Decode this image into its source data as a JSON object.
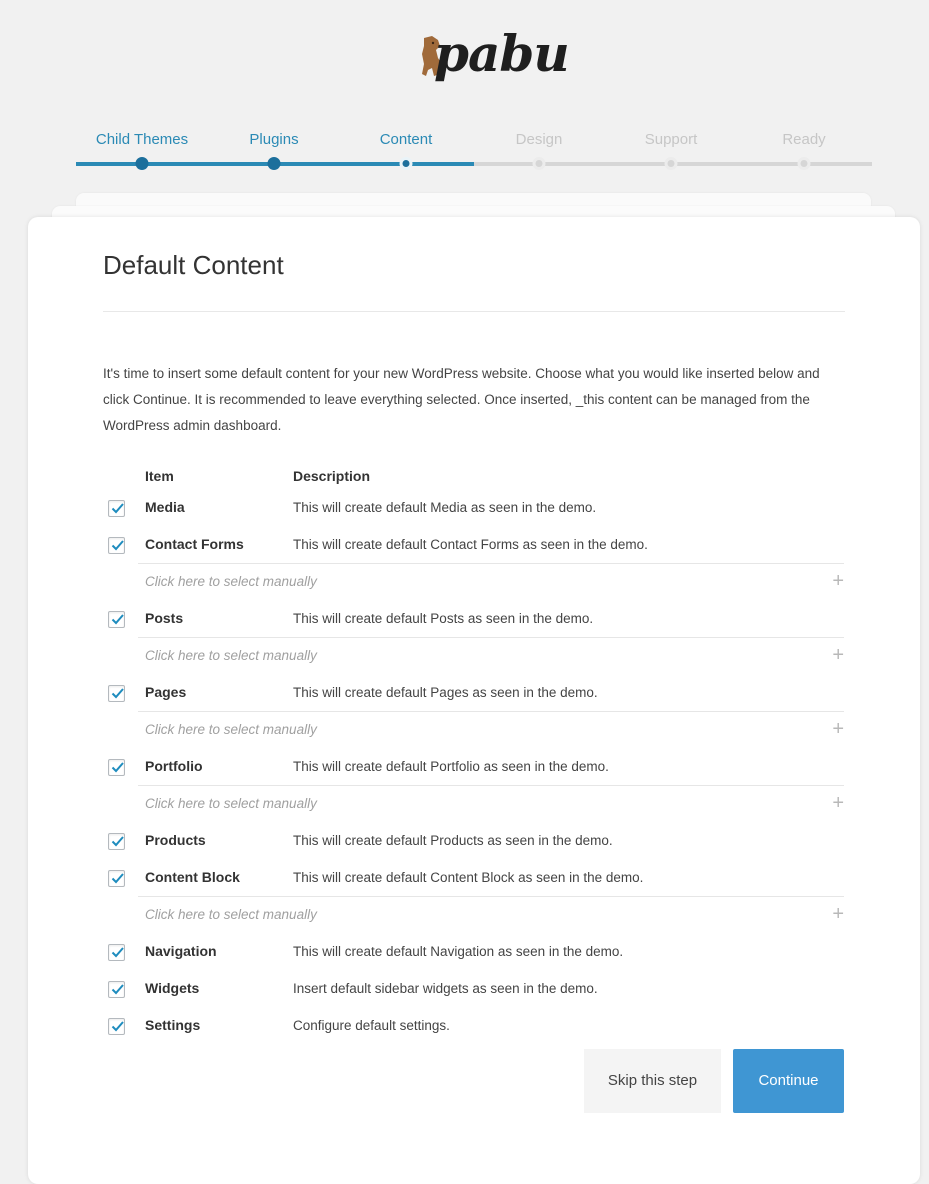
{
  "logo": {
    "text": "pabu",
    "icon": "dog-icon"
  },
  "steps": [
    {
      "label": "Child Themes",
      "state": "done"
    },
    {
      "label": "Plugins",
      "state": "done"
    },
    {
      "label": "Content",
      "state": "current"
    },
    {
      "label": "Design",
      "state": "todo"
    },
    {
      "label": "Support",
      "state": "todo"
    },
    {
      "label": "Ready",
      "state": "todo"
    }
  ],
  "colors": {
    "accent": "#2b8ab5",
    "button_primary": "#3f96d3",
    "inactive": "#c6c6c6"
  },
  "page": {
    "title": "Default Content",
    "intro": "It's time to insert some default content for your new WordPress website. Choose what you would like inserted below and click Continue. It is recommended to leave everything selected. Once inserted, _this content can be managed from the WordPress admin dashboard."
  },
  "table": {
    "headers": {
      "item": "Item",
      "description": "Description"
    },
    "manual_text": "Click here to select manually",
    "rows": [
      {
        "item": "Media",
        "description": "This will create default Media as seen in the demo.",
        "checked": true,
        "manual": false
      },
      {
        "item": "Contact Forms",
        "description": "This will create default Contact Forms as seen in the demo.",
        "checked": true,
        "manual": true
      },
      {
        "item": "Posts",
        "description": "This will create default Posts as seen in the demo.",
        "checked": true,
        "manual": true
      },
      {
        "item": "Pages",
        "description": "This will create default Pages as seen in the demo.",
        "checked": true,
        "manual": true
      },
      {
        "item": "Portfolio",
        "description": "This will create default Portfolio as seen in the demo.",
        "checked": true,
        "manual": true
      },
      {
        "item": "Products",
        "description": "This will create default Products as seen in the demo.",
        "checked": true,
        "manual": false
      },
      {
        "item": "Content Block",
        "description": "This will create default Content Block as seen in the demo.",
        "checked": true,
        "manual": true
      },
      {
        "item": "Navigation",
        "description": "This will create default Navigation as seen in the demo.",
        "checked": true,
        "manual": false
      },
      {
        "item": "Widgets",
        "description": "Insert default sidebar widgets as seen in the demo.",
        "checked": true,
        "manual": false
      },
      {
        "item": "Settings",
        "description": "Configure default settings.",
        "checked": true,
        "manual": false
      }
    ]
  },
  "buttons": {
    "skip": "Skip this step",
    "continue": "Continue"
  }
}
